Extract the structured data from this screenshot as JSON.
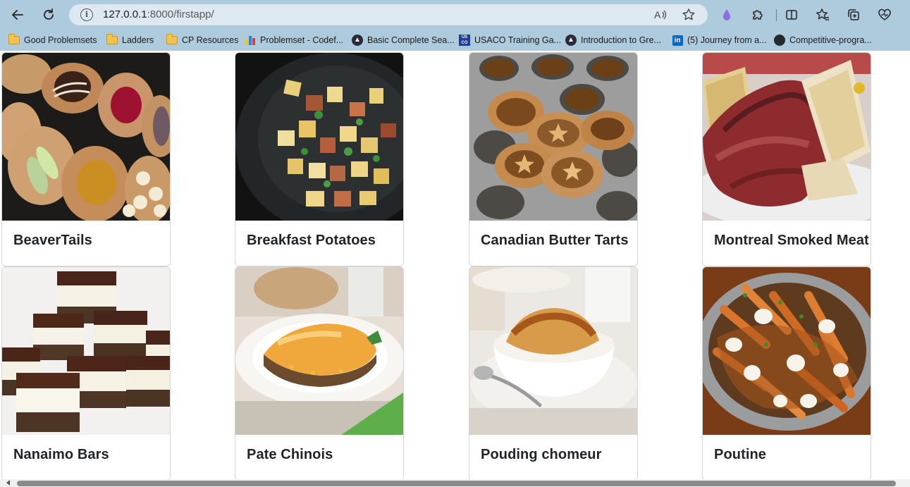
{
  "browser": {
    "url_host": "127.0.0.1",
    "url_path": ":8000/firstapp/"
  },
  "bookmarks": [
    {
      "label": "Good Problemsets",
      "icon": "folder-icon"
    },
    {
      "label": "Ladders",
      "icon": "folder-icon"
    },
    {
      "label": "CP Resources",
      "icon": "folder-icon"
    },
    {
      "label": "Problemset - Codef...",
      "icon": "codeforces-icon"
    },
    {
      "label": "Basic Complete Sea...",
      "icon": "triangle-logo-icon"
    },
    {
      "label": "USACO Training Ga...",
      "icon": "usaco-icon"
    },
    {
      "label": "Introduction to Gre...",
      "icon": "triangle-logo-icon"
    },
    {
      "label": "(5) Journey from a...",
      "icon": "linkedin-icon"
    },
    {
      "label": "Competitive-progra...",
      "icon": "github-icon"
    }
  ],
  "cards": [
    {
      "title": "BeaverTails"
    },
    {
      "title": "Breakfast Potatoes"
    },
    {
      "title": "Canadian Butter Tarts"
    },
    {
      "title": "Montreal Smoked Meat"
    },
    {
      "title": "Nanaimo Bars"
    },
    {
      "title": "Pate Chinois"
    },
    {
      "title": "Pouding chomeur"
    },
    {
      "title": "Poutine"
    }
  ],
  "colors": {
    "browser_chrome": "#aecbdd",
    "address_bar": "#dde8f0",
    "card_title": "#212529",
    "card_border": "#d6d6d6"
  }
}
